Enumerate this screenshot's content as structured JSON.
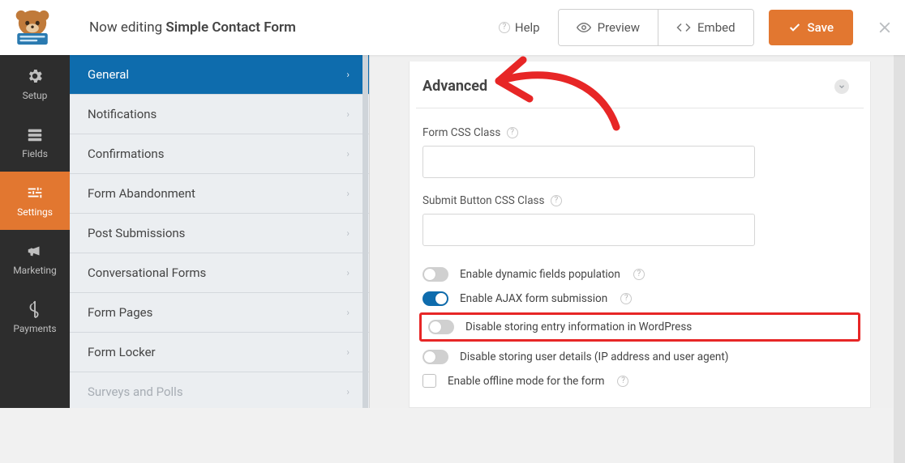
{
  "header": {
    "editing_prefix": "Now editing",
    "form_name": "Simple Contact Form",
    "help_label": "Help",
    "preview_label": "Preview",
    "embed_label": "Embed",
    "save_label": "Save"
  },
  "rail": {
    "items": [
      {
        "label": "Setup"
      },
      {
        "label": "Fields"
      },
      {
        "label": "Settings"
      },
      {
        "label": "Marketing"
      },
      {
        "label": "Payments"
      }
    ]
  },
  "sidebar": {
    "items": [
      {
        "label": "General"
      },
      {
        "label": "Notifications"
      },
      {
        "label": "Confirmations"
      },
      {
        "label": "Form Abandonment"
      },
      {
        "label": "Post Submissions"
      },
      {
        "label": "Conversational Forms"
      },
      {
        "label": "Form Pages"
      },
      {
        "label": "Form Locker"
      },
      {
        "label": "Surveys and Polls"
      }
    ]
  },
  "panel": {
    "section_title": "Advanced",
    "fields": {
      "form_css_label": "Form CSS Class",
      "form_css_value": "",
      "submit_css_label": "Submit Button CSS Class",
      "submit_css_value": ""
    },
    "toggles": {
      "dynamic_fields_label": "Enable dynamic fields population",
      "dynamic_fields_on": false,
      "ajax_label": "Enable AJAX form submission",
      "ajax_on": true,
      "disable_entry_label": "Disable storing entry information in WordPress",
      "disable_entry_on": false,
      "disable_user_label": "Disable storing user details (IP address and user agent)",
      "disable_user_on": false,
      "offline_label": "Enable offline mode for the form",
      "offline_checked": false
    }
  }
}
